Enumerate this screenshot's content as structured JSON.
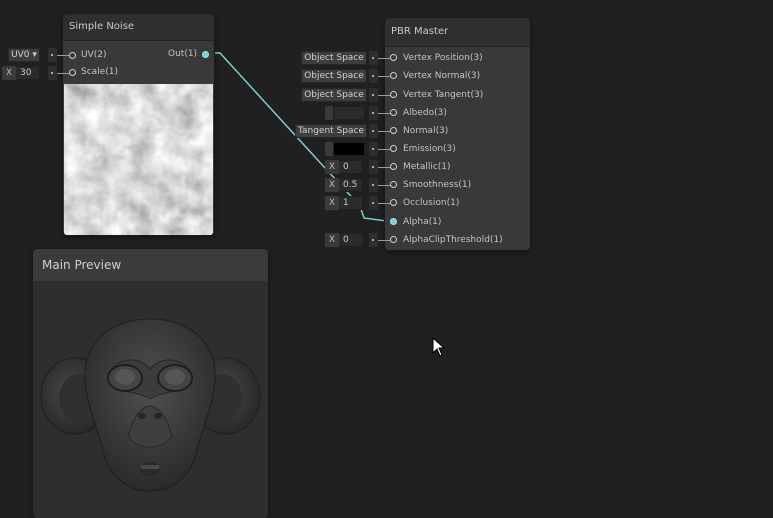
{
  "simple_noise": {
    "title": "Simple Noise",
    "inputs": [
      {
        "label": "UV(2)",
        "field_type": "dropdown",
        "field_value": "UV0"
      },
      {
        "label": "Scale(1)",
        "field_type": "number",
        "field_x": "X",
        "field_value": "30"
      }
    ],
    "output": {
      "label": "Out(1)"
    }
  },
  "pbr_master": {
    "title": "PBR Master",
    "inputs": [
      {
        "label": "Vertex Position(3)",
        "field": "Object Space"
      },
      {
        "label": "Vertex Normal(3)",
        "field": "Object Space"
      },
      {
        "label": "Vertex Tangent(3)",
        "field": "Object Space"
      },
      {
        "label": "Albedo(3)",
        "field": ""
      },
      {
        "label": "Normal(3)",
        "field": "Tangent Space"
      },
      {
        "label": "Emission(3)",
        "field": ""
      },
      {
        "label": "Metallic(1)",
        "field_x": "X",
        "field": "0"
      },
      {
        "label": "Smoothness(1)",
        "field_x": "X",
        "field": "0.5"
      },
      {
        "label": "Occlusion(1)",
        "field_x": "X",
        "field": "1"
      },
      {
        "label": "Alpha(1)",
        "field": ""
      },
      {
        "label": "AlphaClipThreshold(1)",
        "field_x": "X",
        "field": "0"
      }
    ]
  },
  "main_preview": {
    "title": "Main Preview"
  },
  "colors": {
    "wire": "#7ccfcf",
    "background": "#202020",
    "node": "#393939"
  }
}
